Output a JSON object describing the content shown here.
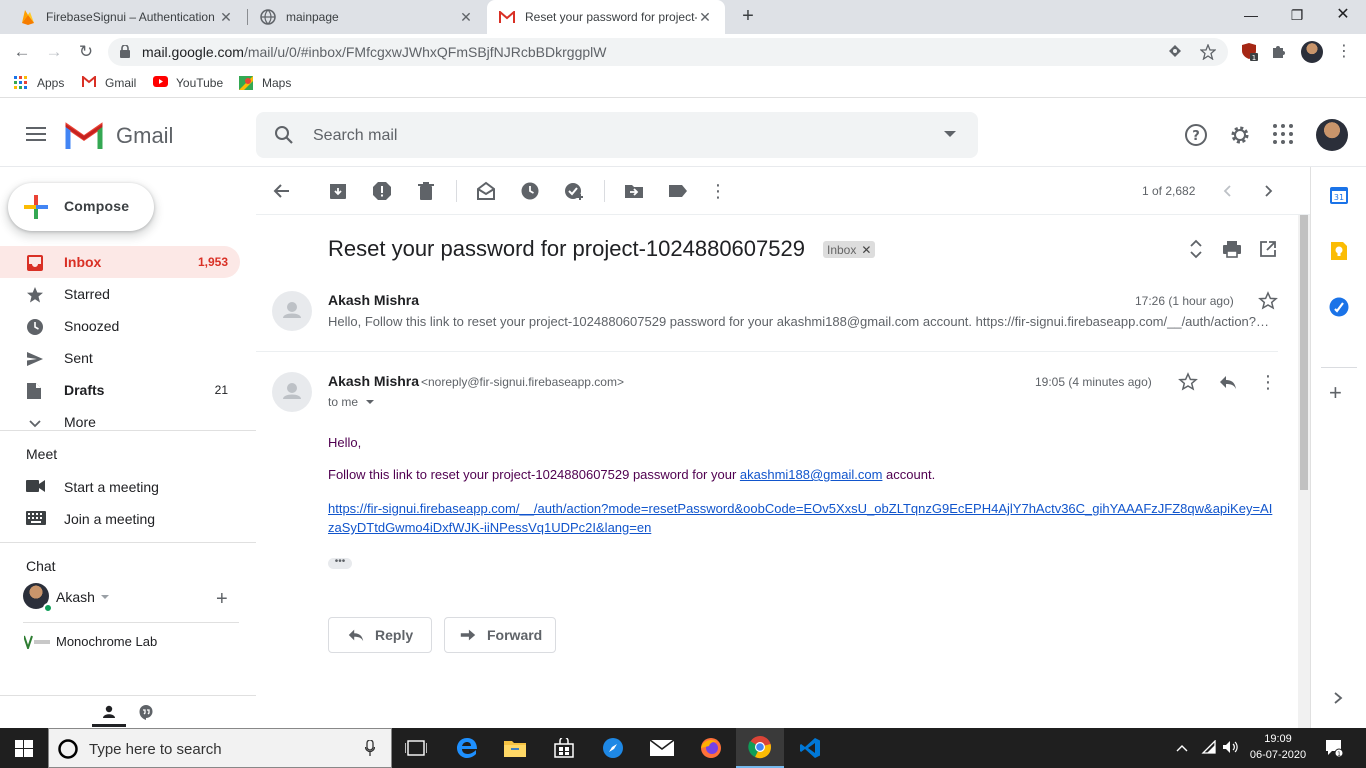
{
  "browser": {
    "tabs": [
      {
        "title": "FirebaseSignui – Authentication",
        "active": false
      },
      {
        "title": "mainpage",
        "active": false
      },
      {
        "title": "Reset your password for project-",
        "active": true
      }
    ],
    "url_host": "mail.google.com",
    "url_path": "/mail/u/0/#inbox/FMfcgxwJWhxQFmSBjfNJRcbBDkrggplW",
    "bookmarks": [
      "Apps",
      "Gmail",
      "YouTube",
      "Maps"
    ]
  },
  "gmail": {
    "wordmark": "Gmail",
    "search_placeholder": "Search mail",
    "compose_label": "Compose",
    "nav": [
      {
        "label": "Inbox",
        "count": "1,953"
      },
      {
        "label": "Starred",
        "count": ""
      },
      {
        "label": "Snoozed",
        "count": ""
      },
      {
        "label": "Sent",
        "count": ""
      },
      {
        "label": "Drafts",
        "count": "21"
      },
      {
        "label": "More",
        "count": ""
      }
    ],
    "meet": {
      "heading": "Meet",
      "items": [
        "Start a meeting",
        "Join a meeting"
      ]
    },
    "chat": {
      "heading": "Chat",
      "user": "Akash",
      "room": "Monochrome Lab"
    },
    "pager": "1 of 2,682"
  },
  "message": {
    "subject": "Reset your password for project-1024880607529",
    "label": "Inbox",
    "collapsed": {
      "sender": "Akash Mishra",
      "time": "17:26 (1 hour ago)",
      "snippet": "Hello, Follow this link to reset your project-1024880607529 password for your akashmi188@gmail.com account. https://fir-signui.firebaseapp.com/__/auth/action?mode=resetPassword"
    },
    "expanded": {
      "sender": "Akash Mishra",
      "email": "<noreply@fir-signui.firebaseapp.com>",
      "time": "19:05 (4 minutes ago)",
      "to": "to me",
      "greeting": "Hello,",
      "line_before": "Follow this link to reset your project-1024880607529 password for your ",
      "email_link": "akashmi188@gmail.com",
      "line_after": " account.",
      "reset_link": "https://fir-signui.firebaseapp.com/__/auth/action?mode=resetPassword&oobCode=EOv5XxsU_obZLTqnzG9EcEPH4AjlY7hActv36C_gihYAAAFzJFZ8qw&apiKey=AIzaSyDTtdGwmo4iDxfWJK-iiNPessVq1UDPc2I&lang=en"
    },
    "reply_label": "Reply",
    "forward_label": "Forward"
  },
  "taskbar": {
    "search_placeholder": "Type here to search",
    "time": "19:09",
    "date": "06-07-2020"
  },
  "colors": {
    "gmail_red": "#d93025",
    "inbox_bg": "#fce8e6",
    "link": "#1155cc",
    "body_text": "#500050"
  }
}
